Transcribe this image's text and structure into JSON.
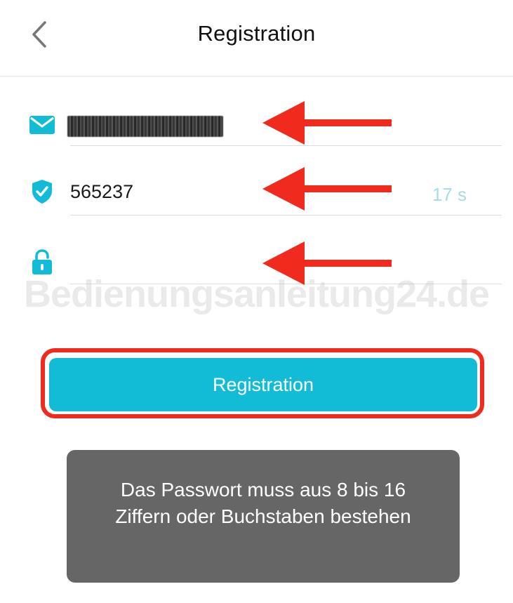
{
  "header": {
    "title": "Registration",
    "back_icon": "chevron-left-icon"
  },
  "form": {
    "email": {
      "icon": "mail-icon",
      "value": "",
      "redacted": true
    },
    "code": {
      "icon": "shield-check-icon",
      "value": "565237",
      "countdown": "17 s"
    },
    "password": {
      "icon": "lock-icon",
      "value": ""
    }
  },
  "watermark": "Bedienungsanleitung24.de",
  "register_button": {
    "label": "Registration"
  },
  "toast": {
    "lines": [
      "Das Passwort muss aus 8 bis 16",
      "Ziffern oder Buchstaben bestehen"
    ]
  },
  "colors": {
    "accent": "#12bcd6",
    "countdown": "#a8dde8",
    "annotation": "#f02a1c",
    "toast_bg": "#666666"
  }
}
